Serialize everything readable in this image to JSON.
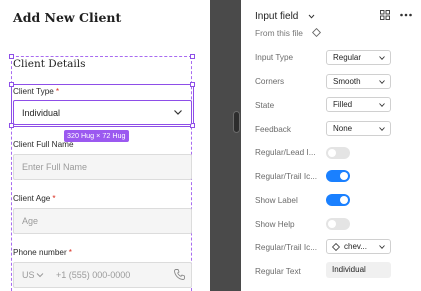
{
  "form": {
    "title": "Add New Client",
    "section_title": "Client Details",
    "client_type": {
      "label": "Client Type",
      "required": "*",
      "value": "Individual"
    },
    "hug_tag": "320 Hug × 72 Hug",
    "full_name": {
      "label": "Client Full Name",
      "placeholder": "Enter Full Name"
    },
    "age": {
      "label": "Client Age",
      "required": "*",
      "placeholder": "Age"
    },
    "phone": {
      "label": "Phone number",
      "required": "*",
      "country": "US",
      "placeholder": "+1 (555) 000-0000"
    }
  },
  "panel": {
    "title": "Input field",
    "from_file": "From this file",
    "input_type": {
      "label": "Input Type",
      "value": "Regular"
    },
    "corners": {
      "label": "Corners",
      "value": "Smooth"
    },
    "state": {
      "label": "State",
      "value": "Filled"
    },
    "feedback": {
      "label": "Feedback",
      "value": "None"
    },
    "regular_lead": {
      "label": "Regular/Lead I...",
      "on": false
    },
    "regular_trail": {
      "label": "Regular/Trail Ic...",
      "on": true
    },
    "show_label": {
      "label": "Show Label",
      "on": true
    },
    "show_help": {
      "label": "Show Help",
      "on": false
    },
    "trail_icon_swap": {
      "label": "Regular/Trail Ic...",
      "value": "chev..."
    },
    "regular_text": {
      "label": "Regular Text",
      "value": "Individual"
    }
  },
  "colors": {
    "selection": "#8e4ee8",
    "hug_tag": "#9b59f0",
    "toggle_on": "#1a80ff",
    "divider": "#4a4a4a",
    "required": "#d92d20"
  },
  "icons": [
    "chevron-down-icon",
    "phone-icon",
    "grid-icon",
    "more-icon",
    "component-diamond-icon"
  ]
}
